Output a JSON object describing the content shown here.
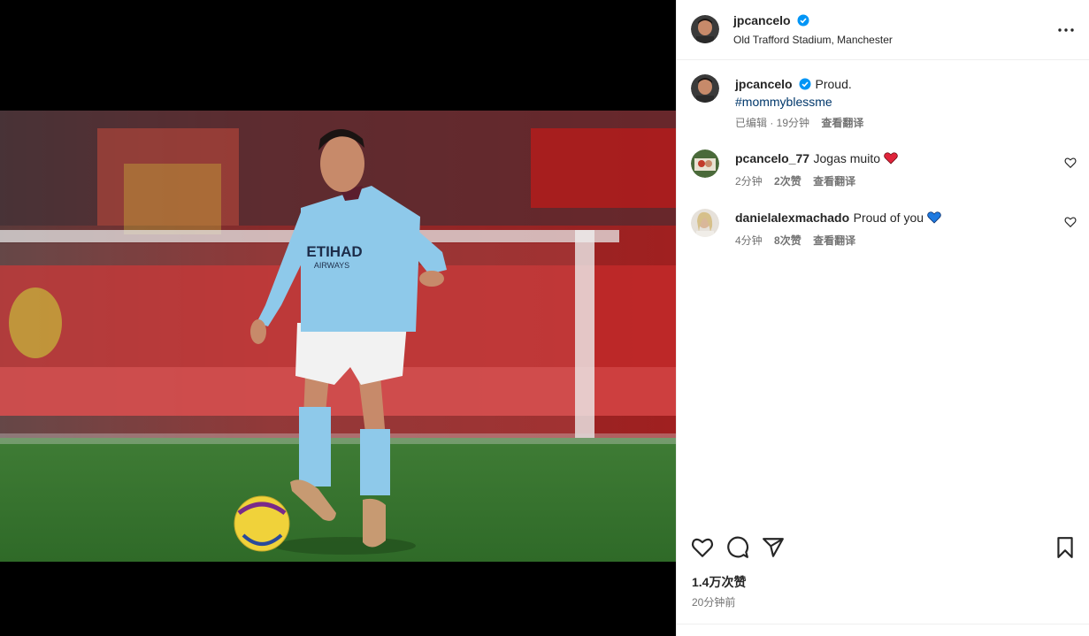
{
  "header": {
    "username": "jpcancelo",
    "location": "Old Trafford Stadium, Manchester",
    "more_icon": "more-horizontal-icon",
    "verified_icon": "verified-badge-icon"
  },
  "caption": {
    "username": "jpcancelo",
    "text": "Proud.",
    "hashtag": "#mommyblessme",
    "edited": "已编辑 · 19分钟",
    "translate": "查看翻译"
  },
  "comments": [
    {
      "username": "pcancelo_77",
      "text": "Jogas muito",
      "emoji": "❤️",
      "time": "2分钟",
      "likes": "2次赞",
      "translate": "查看翻译"
    },
    {
      "username": "danielalexmachado",
      "text": "Proud of you",
      "emoji": "💙",
      "time": "4分钟",
      "likes": "8次赞",
      "translate": "查看翻译"
    }
  ],
  "actions": {
    "like_icon": "heart-icon",
    "comment_icon": "comment-icon",
    "share_icon": "share-icon",
    "save_icon": "bookmark-icon"
  },
  "likes_count": "1.4万次赞",
  "post_time": "20分钟前",
  "photo": {
    "shirt_sponsor": "ETIHAD",
    "shirt_sponsor_sub": "AIRWAYS"
  },
  "colors": {
    "verified": "#0095f6",
    "hashtag": "#00376b",
    "secondary_text": "#737373",
    "heart_red": "#ed4956",
    "heart_blue": "#1877f2"
  }
}
